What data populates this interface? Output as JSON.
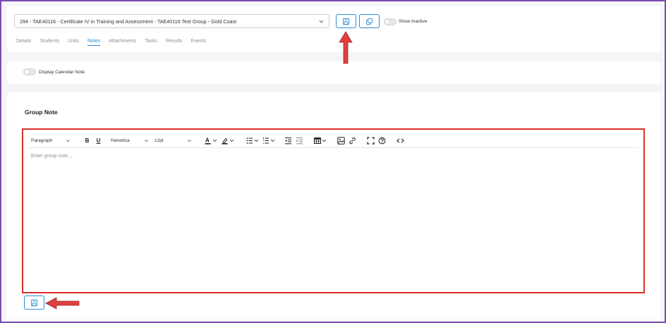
{
  "header": {
    "group_select_value": "294 - TAE40116 - Certificate IV in Training and Assessment - TAE40116 Test Group - Gold Coast",
    "show_inactive_label": "Show Inactive"
  },
  "tabs": [
    {
      "label": "Details"
    },
    {
      "label": "Students"
    },
    {
      "label": "Units"
    },
    {
      "label": "Notes"
    },
    {
      "label": "Attachments"
    },
    {
      "label": "Tasks"
    },
    {
      "label": "Results"
    },
    {
      "label": "Events"
    }
  ],
  "active_tab": "Notes",
  "calendar": {
    "toggle_label": "Display Calendar Note"
  },
  "note": {
    "section_title": "Group Note",
    "placeholder": "Enter group note....",
    "toolbar": {
      "block_format": "Paragraph",
      "font_family": "Helvetica",
      "font_size": "12pt",
      "bold_label": "B",
      "underline_label": "U",
      "text_color_label": "A"
    }
  },
  "icons": [
    "chevron-down-icon",
    "save-icon",
    "copy-icon",
    "bold-icon",
    "underline-icon",
    "text-color-icon",
    "highlight-icon",
    "bullet-list-icon",
    "numbered-list-icon",
    "outdent-icon",
    "indent-icon",
    "table-icon",
    "image-icon",
    "link-icon",
    "fullscreen-icon",
    "help-icon",
    "source-code-icon",
    "arrow-icon"
  ],
  "colors": {
    "accent": "#2a8dd4",
    "frame_border": "#7b4bb0",
    "highlight_border": "#d9302b",
    "arrow": "#e04040"
  }
}
